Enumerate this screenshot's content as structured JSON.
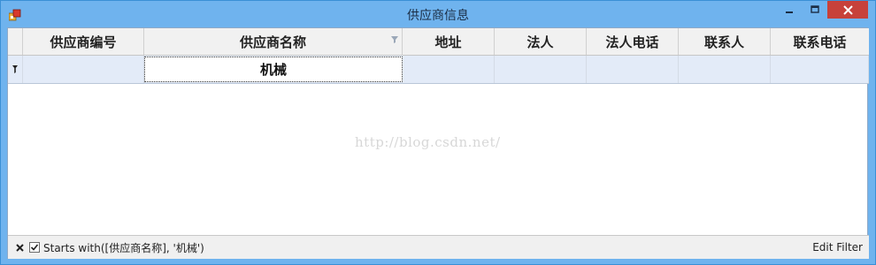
{
  "window": {
    "title": "供应商信息"
  },
  "grid": {
    "columns": [
      "供应商编号",
      "供应商名称",
      "地址",
      "法人",
      "法人电话",
      "联系人",
      "联系电话"
    ],
    "filter_row": {
      "supplier_name": "机械"
    }
  },
  "watermark": "http://blog.csdn.net/",
  "filter_panel": {
    "checked": true,
    "expression": "Starts with([供应商名称], '机械')",
    "edit_label": "Edit Filter"
  },
  "colors": {
    "titlebar": "#6fb3ee",
    "close_button": "#c7413a",
    "filter_row": "#e3ebf8"
  }
}
